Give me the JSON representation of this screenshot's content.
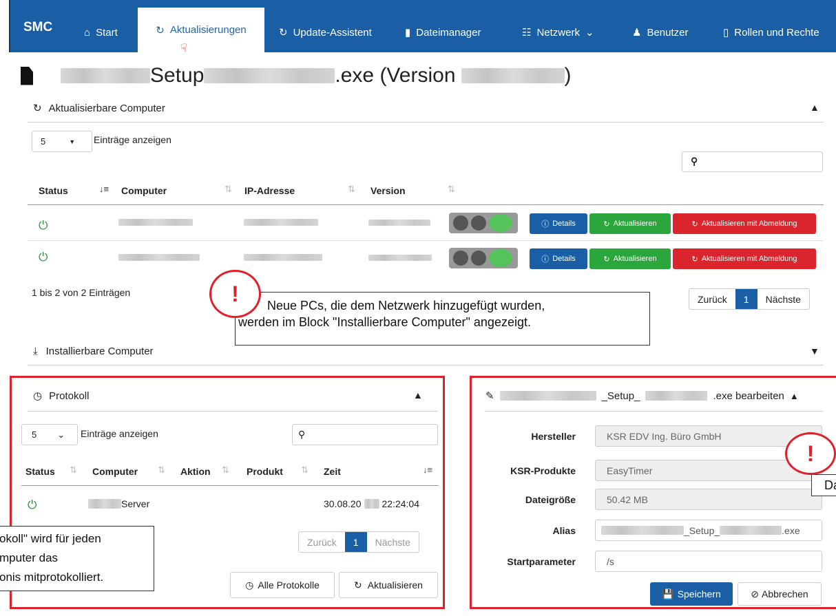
{
  "nav": {
    "brand": "SMC",
    "items": {
      "start": "Start",
      "updates": "Aktualisierungen",
      "assistant": "Update-Assistent",
      "files": "Dateimanager",
      "network": "Netzwerk",
      "users": "Benutzer",
      "roles": "Rollen und Rechte"
    }
  },
  "page": {
    "title_mid": "Setup",
    "title_ext": ".exe (Version",
    "title_end": ")"
  },
  "updatable": {
    "heading": "Aktualisierbare Computer",
    "page_size": "5",
    "entries_label": "Einträge anzeigen",
    "search_placeholder": "",
    "columns": {
      "status": "Status",
      "computer": "Computer",
      "ip": "IP-Adresse",
      "version": "Version"
    },
    "buttons": {
      "details": "Details",
      "update": "Aktualisieren",
      "update_logoff": "Aktualisieren mit Abmeldung"
    },
    "info": "1 bis 2 von 2 Einträgen",
    "pager": {
      "prev": "Zurück",
      "page": "1",
      "next": "Nächste"
    }
  },
  "installable": {
    "heading": "Installierbare Computer"
  },
  "callout_top": {
    "mark": "!",
    "line1": "Neue PCs, die dem Netzwerk hinzugefügt wurden,",
    "line2": "werden im Block \"Installierbare Computer\" angezeigt."
  },
  "protocol": {
    "heading": "Protokoll",
    "page_size": "5",
    "entries_label": "Einträge anzeigen",
    "columns": {
      "status": "Status",
      "computer": "Computer",
      "action": "Aktion",
      "product": "Produkt",
      "time": "Zeit"
    },
    "row": {
      "computer_suffix": "Server",
      "time_a": "30.08.20",
      "time_b": "22:24:04"
    },
    "pager": {
      "prev": "Zurück",
      "page": "1",
      "next": "Nächste"
    },
    "all_logs": "Alle Protokolle",
    "refresh": "Aktualisieren"
  },
  "callout_left": {
    "line1": "okoll\" wird für jeden",
    "line2": "mputer das",
    "line3": "onis mitprotokolliert."
  },
  "edit": {
    "heading_mid": "_Setup_",
    "heading_end": ".exe bearbeiten",
    "labels": {
      "vendor": "Hersteller",
      "products": "KSR-Produkte",
      "size": "Dateigröße",
      "alias": "Alias",
      "params": "Startparameter"
    },
    "values": {
      "vendor": "KSR EDV Ing. Büro GmbH",
      "products": "EasyTimer",
      "size": "50.42 MB",
      "alias_mid": "_Setup_",
      "alias_end": ".exe",
      "params": "/s"
    },
    "save": "Speichern",
    "cancel": "Abbrechen"
  },
  "callout_right": {
    "mark": "!",
    "text": "Da"
  }
}
